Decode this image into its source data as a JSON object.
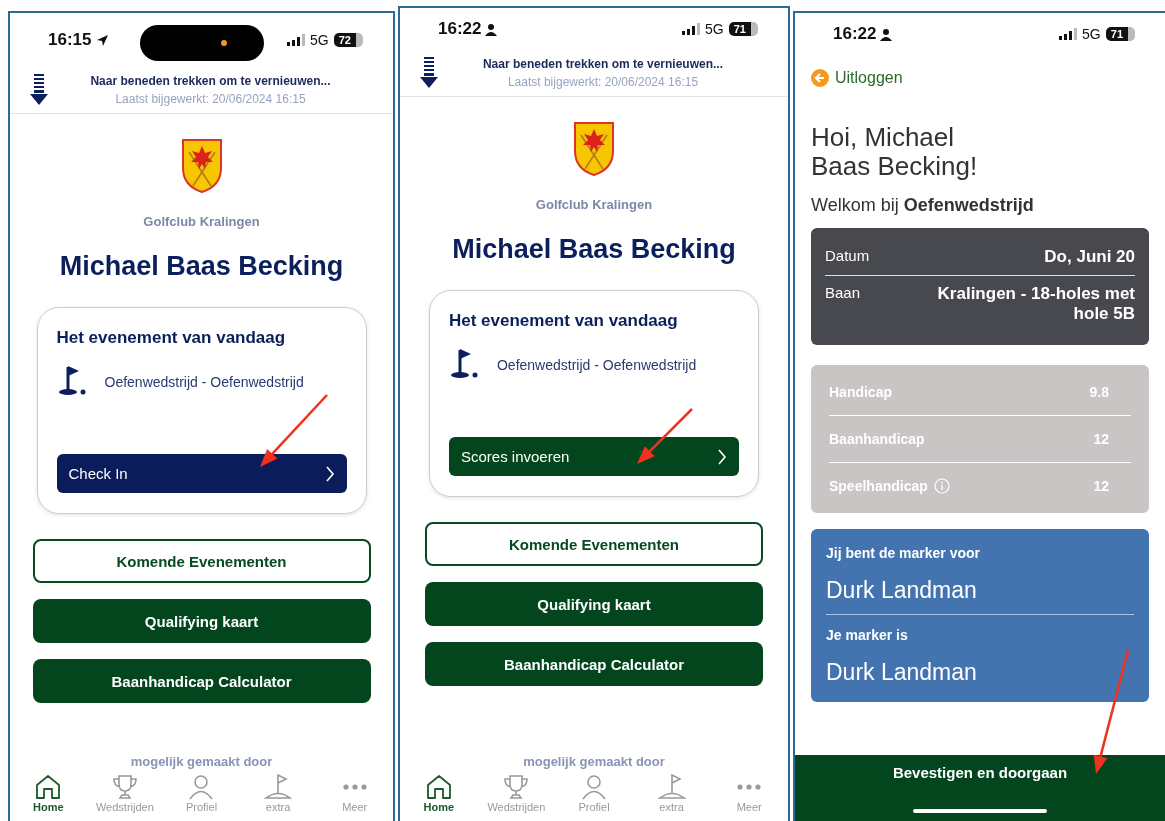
{
  "screens": [
    {
      "kind": "home",
      "status_bar": {
        "time": "16:15",
        "indicator": {
          "kind": "location"
        },
        "dynamic_island": true,
        "network": "5G",
        "battery": "72"
      },
      "refresh_hint": "Naar beneden trekken om te vernieuwen...",
      "last_updated": "Laatst bijgewerkt: 20/06/2024 16:15",
      "club_name": "Golfclub Kralingen",
      "player_name": "Michael Baas Becking",
      "event_card": {
        "title": "Het evenement van vandaag",
        "event": "Oefenwedstrijd - Oefenwedstrijd",
        "action": {
          "label": "Check In",
          "kind": "check_in"
        }
      },
      "buttons": [
        {
          "label": "Komende Evenementen",
          "kind": "outline"
        },
        {
          "label": "Qualifying kaart",
          "kind": "filled"
        },
        {
          "label": "Baanhandicap Calculator",
          "kind": "filled"
        }
      ],
      "footer": "mogelijk gemaakt door",
      "tabs": [
        {
          "label": "Home",
          "kind": "home",
          "selected": true
        },
        {
          "label": "Wedstrijden",
          "kind": "trophy",
          "selected": false
        },
        {
          "label": "Profiel",
          "kind": "person",
          "selected": false
        },
        {
          "label": "extra",
          "kind": "flag",
          "selected": false
        },
        {
          "label": "Meer",
          "kind": "more",
          "selected": false
        }
      ],
      "annotation_arrow": true
    },
    {
      "kind": "home",
      "status_bar": {
        "time": "16:22",
        "indicator": {
          "kind": "person"
        },
        "dynamic_island": false,
        "network": "5G",
        "battery": "71"
      },
      "refresh_hint": "Naar beneden trekken om te vernieuwen...",
      "last_updated": "Laatst bijgewerkt: 20/06/2024 16:15",
      "club_name": "Golfclub Kralingen",
      "player_name": "Michael Baas Becking",
      "event_card": {
        "title": "Het evenement van vandaag",
        "event": "Oefenwedstrijd - Oefenwedstrijd",
        "action": {
          "label": "Scores invoeren",
          "kind": "scores"
        }
      },
      "buttons": [
        {
          "label": "Komende Evenementen",
          "kind": "outline"
        },
        {
          "label": "Qualifying kaart",
          "kind": "filled"
        },
        {
          "label": "Baanhandicap Calculator",
          "kind": "filled"
        }
      ],
      "footer": "mogelijk gemaakt door",
      "tabs": [
        {
          "label": "Home",
          "kind": "home",
          "selected": true
        },
        {
          "label": "Wedstrijden",
          "kind": "trophy",
          "selected": false
        },
        {
          "label": "Profiel",
          "kind": "person",
          "selected": false
        },
        {
          "label": "extra",
          "kind": "flag",
          "selected": false
        },
        {
          "label": "Meer",
          "kind": "more",
          "selected": false
        }
      ],
      "annotation_arrow": true
    },
    {
      "kind": "confirm",
      "status_bar": {
        "time": "16:22",
        "indicator": {
          "kind": "person"
        },
        "dynamic_island": false,
        "network": "5G",
        "battery": "71"
      },
      "back_link": "Uitloggen",
      "greeting": "Hoi,  Michael Baas Becking!",
      "welcome": "Welkom bij  **Oefenwedstrijd**",
      "details": [
        {
          "label": "Datum",
          "value": "Do, Juni 20"
        },
        {
          "label": "Baan",
          "value": "Kralingen - 18-holes met hole 5B"
        }
      ],
      "handicaps": [
        {
          "label": "Handicap",
          "value": "9.8",
          "info": false
        },
        {
          "label": "Baanhandicap",
          "value": "12",
          "info": false
        },
        {
          "label": "Speelhandicap",
          "value": "12",
          "info": true
        }
      ],
      "markers": [
        {
          "label": "Jij bent de marker voor",
          "name": "Durk Landman"
        },
        {
          "label": "Je marker is",
          "name": "Durk Landman"
        }
      ],
      "confirm_button": "Bevestigen en doorgaan",
      "annotation_arrow": true
    }
  ]
}
